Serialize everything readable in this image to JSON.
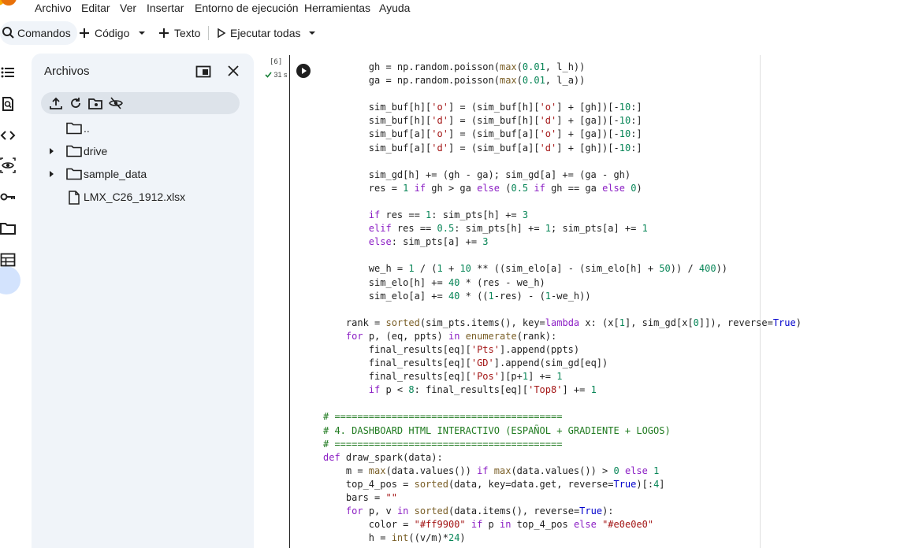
{
  "menu": {
    "items": [
      "Archivo",
      "Editar",
      "Ver",
      "Insertar",
      "Entorno de ejecución",
      "Herramientas",
      "Ayuda"
    ]
  },
  "toolbar": {
    "commands_label": "Comandos",
    "code_label": "Código",
    "text_label": "Texto",
    "run_all_label": "Ejecutar todas"
  },
  "files": {
    "title": "Archivos",
    "tree": [
      {
        "label": "..",
        "type": "folder",
        "expandable": false
      },
      {
        "label": "drive",
        "type": "folder",
        "expandable": true
      },
      {
        "label": "sample_data",
        "type": "folder",
        "expandable": true
      },
      {
        "label": "LMX_C26_1912.xlsx",
        "type": "file",
        "expandable": false
      }
    ]
  },
  "cell": {
    "execution_count": "[6]",
    "status": "31 s",
    "code_lines": [
      "        gh = np.random.poisson(max(0.01, l_h))",
      "        ga = np.random.poisson(max(0.01, l_a))",
      "",
      "        sim_buf[h]['o'] = (sim_buf[h]['o'] + [gh])[-10:]",
      "        sim_buf[h]['d'] = (sim_buf[h]['d'] + [ga])[-10:]",
      "        sim_buf[a]['o'] = (sim_buf[a]['o'] + [ga])[-10:]",
      "        sim_buf[a]['d'] = (sim_buf[a]['d'] + [gh])[-10:]",
      "",
      "        sim_gd[h] += (gh - ga); sim_gd[a] += (ga - gh)",
      "        res = 1 if gh > ga else (0.5 if gh == ga else 0)",
      "",
      "        if res == 1: sim_pts[h] += 3",
      "        elif res == 0.5: sim_pts[h] += 1; sim_pts[a] += 1",
      "        else: sim_pts[a] += 3",
      "",
      "        we_h = 1 / (1 + 10 ** ((sim_elo[a] - (sim_elo[h] + 50)) / 400))",
      "        sim_elo[h] += 40 * (res - we_h)",
      "        sim_elo[a] += 40 * ((1-res) - (1-we_h))",
      "",
      "    rank = sorted(sim_pts.items(), key=lambda x: (x[1], sim_gd[x[0]]), reverse=True)",
      "    for p, (eq, ppts) in enumerate(rank):",
      "        final_results[eq]['Pts'].append(ppts)",
      "        final_results[eq]['GD'].append(sim_gd[eq])",
      "        final_results[eq]['Pos'][p+1] += 1",
      "        if p < 8: final_results[eq]['Top8'] += 1",
      "",
      "# ========================================",
      "# 4. DASHBOARD HTML INTERACTIVO (ESPAÑOL + GRADIENTE + LOGOS)",
      "# ========================================",
      "def draw_spark(data):",
      "    m = max(data.values()) if max(data.values()) > 0 else 1",
      "    top_4_pos = sorted(data, key=data.get, reverse=True)[:4]",
      "    bars = \"\"",
      "    for p, v in sorted(data.items(), reverse=True):",
      "        color = \"#ff9900\" if p in top_4_pos else \"#e0e0e0\"",
      "        h = int((v/m)*24)"
    ]
  },
  "colors": {
    "accent": "#0b57d0",
    "panel_bg": "#f0f4f9",
    "active_rail": "#d3e3fd",
    "status_ok": "#188038"
  }
}
